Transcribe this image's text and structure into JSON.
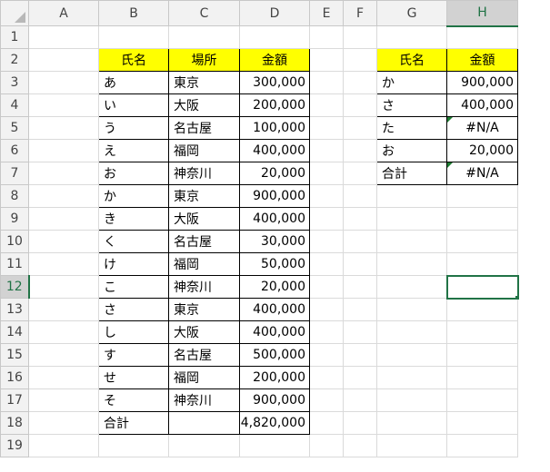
{
  "sheet": {
    "columns": [
      "A",
      "B",
      "C",
      "D",
      "E",
      "F",
      "G",
      "H"
    ],
    "active_column": "H",
    "active_row": "12",
    "rows": [
      "1",
      "2",
      "3",
      "4",
      "5",
      "6",
      "7",
      "8",
      "9",
      "10",
      "11",
      "12",
      "13",
      "14",
      "15",
      "16",
      "17",
      "18",
      "19"
    ],
    "left_table": {
      "headers": [
        "氏名",
        "場所",
        "金額"
      ],
      "records": [
        [
          "あ",
          "東京",
          "300,000"
        ],
        [
          "い",
          "大阪",
          "200,000"
        ],
        [
          "う",
          "名古屋",
          "100,000"
        ],
        [
          "え",
          "福岡",
          "400,000"
        ],
        [
          "お",
          "神奈川",
          "20,000"
        ],
        [
          "か",
          "東京",
          "900,000"
        ],
        [
          "き",
          "大阪",
          "400,000"
        ],
        [
          "く",
          "名古屋",
          "30,000"
        ],
        [
          "け",
          "福岡",
          "50,000"
        ],
        [
          "こ",
          "神奈川",
          "20,000"
        ],
        [
          "さ",
          "東京",
          "400,000"
        ],
        [
          "し",
          "大阪",
          "400,000"
        ],
        [
          "す",
          "名古屋",
          "500,000"
        ],
        [
          "せ",
          "福岡",
          "200,000"
        ],
        [
          "そ",
          "神奈川",
          "900,000"
        ]
      ],
      "total_label": "合計",
      "total_place": "",
      "total_amount": "4,820,000"
    },
    "right_table": {
      "headers": [
        "氏名",
        "金額"
      ],
      "records": [
        [
          "か",
          "900,000"
        ],
        [
          "さ",
          "400,000"
        ],
        [
          "た",
          "#N/A"
        ],
        [
          "お",
          "20,000"
        ]
      ],
      "total_label": "合計",
      "total_amount": "#N/A"
    },
    "colors": {
      "header_fill": "#ffff00",
      "selection": "#217346",
      "error_marker": "#1e7c32"
    }
  }
}
